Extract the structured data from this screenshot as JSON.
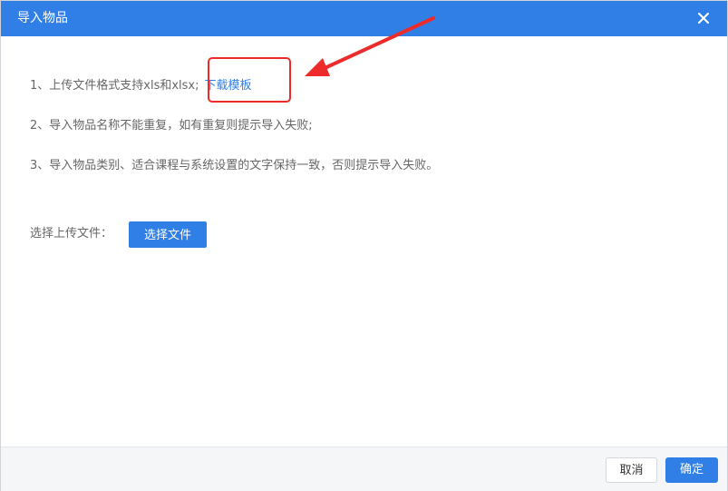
{
  "dialog": {
    "title": "导入物品",
    "close_icon": "close-icon"
  },
  "instructions": {
    "line1_text": "1、上传文件格式支持xls和xlsx;",
    "download_link": "下载模板",
    "line2_text": "2、导入物品名称不能重复，如有重复则提示导入失败;",
    "line3_text": "3、导入物品类别、适合课程与系统设置的文字保持一致，否则提示导入失败。"
  },
  "upload": {
    "label": "选择上传文件：",
    "button_label": "选择文件"
  },
  "footer": {
    "cancel_label": "取消",
    "confirm_label": "确定"
  },
  "colors": {
    "accent": "#2f7fe6",
    "annotation": "#ee2b2b"
  }
}
